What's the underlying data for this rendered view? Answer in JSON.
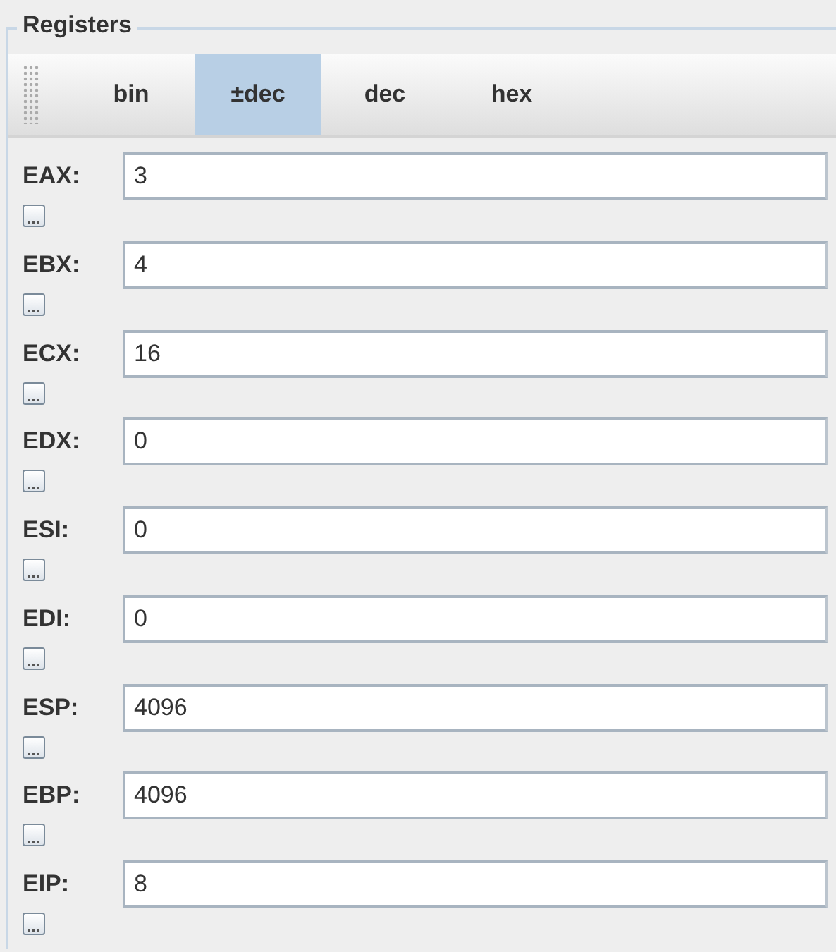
{
  "panel": {
    "title": "Registers"
  },
  "tabs": [
    {
      "label": "bin",
      "selected": false
    },
    {
      "label": "±dec",
      "selected": true
    },
    {
      "label": "dec",
      "selected": false
    },
    {
      "label": "hex",
      "selected": false
    }
  ],
  "registers": [
    {
      "name": "EAX:",
      "value": "3"
    },
    {
      "name": "EBX:",
      "value": "4"
    },
    {
      "name": "ECX:",
      "value": "16"
    },
    {
      "name": "EDX:",
      "value": "0"
    },
    {
      "name": "ESI:",
      "value": "0"
    },
    {
      "name": "EDI:",
      "value": "0"
    },
    {
      "name": "ESP:",
      "value": "4096"
    },
    {
      "name": "EBP:",
      "value": "4096"
    },
    {
      "name": "EIP:",
      "value": "8"
    }
  ]
}
